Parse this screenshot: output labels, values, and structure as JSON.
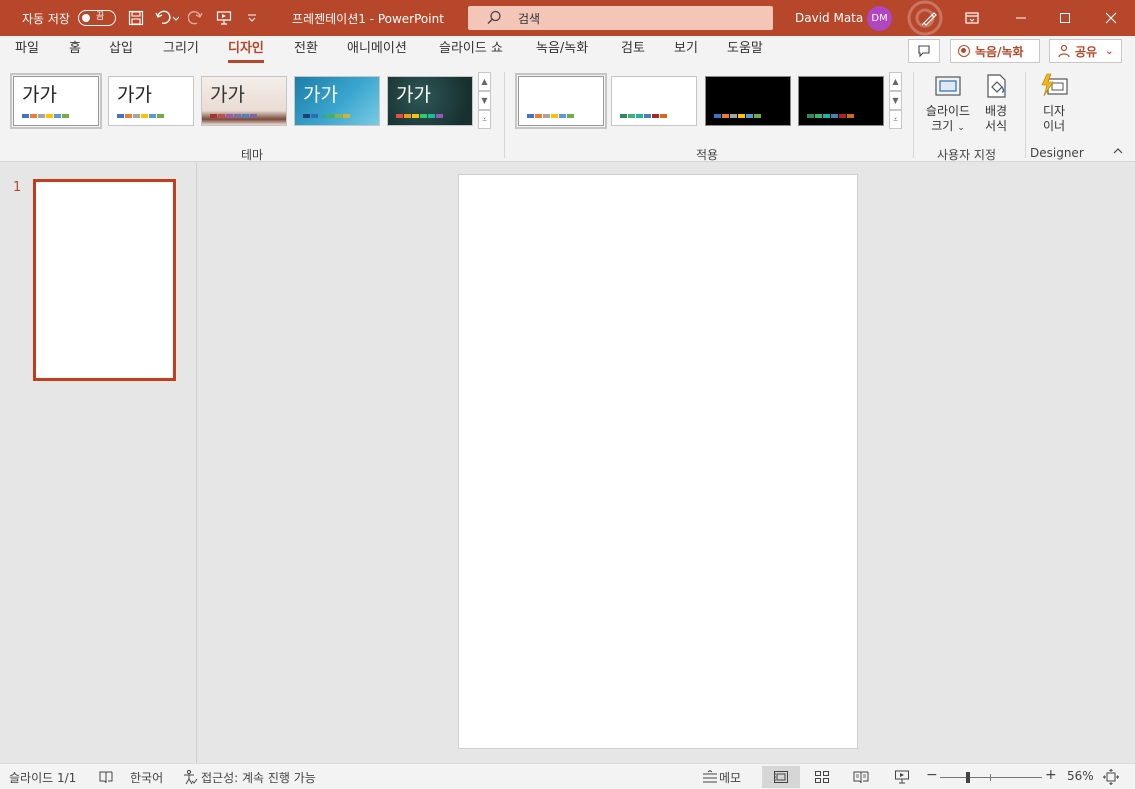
{
  "titlebar": {
    "autosave_label": "자동 저장",
    "autosave_state": "끔",
    "document_title": "프레젠테이션1  -  PowerPoint",
    "search_placeholder": "검색",
    "user_name": "David Mata",
    "user_initials": "DM",
    "accent_color": "#b7472a"
  },
  "tabs": [
    "파일",
    "홈",
    "삽입",
    "그리기",
    "디자인",
    "전환",
    "애니메이션",
    "슬라이드 쇼",
    "녹음/녹화",
    "검토",
    "보기",
    "도움말"
  ],
  "active_tab": "디자인",
  "tab_actions": {
    "record_label": "녹음/녹화",
    "share_label": "공유"
  },
  "ribbon": {
    "themes": {
      "group_label": "테마",
      "thumb_text": "가가",
      "items": [
        {
          "bg": "#ffffff",
          "text_color": "#222222",
          "colors": [
            "#4472c4",
            "#ed7d31",
            "#a5a5a5",
            "#ffc000",
            "#5b9bd5",
            "#70ad47"
          ]
        },
        {
          "bg": "#ffffff",
          "text_color": "#222222",
          "colors": [
            "#4472c4",
            "#ed7d31",
            "#a5a5a5",
            "#ffc000",
            "#5b9bd5",
            "#70ad47"
          ]
        },
        {
          "bg": "#f2ebe6",
          "text_color": "#333333",
          "colors": [
            "#a83232",
            "#c0504d",
            "#9b5ea6",
            "#7b6ea8",
            "#4f81bd",
            "#8064a2"
          ]
        },
        {
          "bg": "#2a8fb8",
          "text_color": "#ffffff",
          "colors": [
            "#1f3d7a",
            "#2b6fb0",
            "#38a0b0",
            "#47b05a",
            "#89b64a",
            "#d0b33b"
          ]
        },
        {
          "bg": "#1f3b3a",
          "text_color": "#ffffff",
          "colors": [
            "#e84c3d",
            "#f39c12",
            "#f1c40f",
            "#2ecc71",
            "#1abc9c",
            "#9b59b6"
          ]
        }
      ]
    },
    "variants": {
      "group_label": "적용",
      "items": [
        {
          "dark": false,
          "colors": [
            "#4472c4",
            "#ed7d31",
            "#a5a5a5",
            "#ffc000",
            "#5b9bd5",
            "#70ad47"
          ]
        },
        {
          "dark": false,
          "colors": [
            "#2e8b57",
            "#3cb371",
            "#20b2aa",
            "#4682b4",
            "#b22222",
            "#d2691e"
          ]
        },
        {
          "dark": true,
          "colors": [
            "#4472c4",
            "#ed7d31",
            "#a5a5a5",
            "#ffc000",
            "#5b9bd5",
            "#70ad47"
          ]
        },
        {
          "dark": true,
          "colors": [
            "#2e8b57",
            "#3cb371",
            "#20b2aa",
            "#4682b4",
            "#b22222",
            "#d2691e"
          ]
        }
      ]
    },
    "customize": {
      "group_label": "사용자 지정",
      "slide_size_line1": "슬라이드",
      "slide_size_line2": "크기",
      "bg_format_line1": "배경",
      "bg_format_line2": "서식"
    },
    "designer": {
      "group_label": "Designer",
      "btn_line1": "디자",
      "btn_line2": "이너"
    }
  },
  "thumbnails": {
    "slide_number": "1"
  },
  "statusbar": {
    "slide_info": "슬라이드 1/1",
    "language": "한국어",
    "accessibility": "접근성: 계속 진행 가능",
    "notes_label": "메모",
    "zoom_percent": "56%"
  }
}
